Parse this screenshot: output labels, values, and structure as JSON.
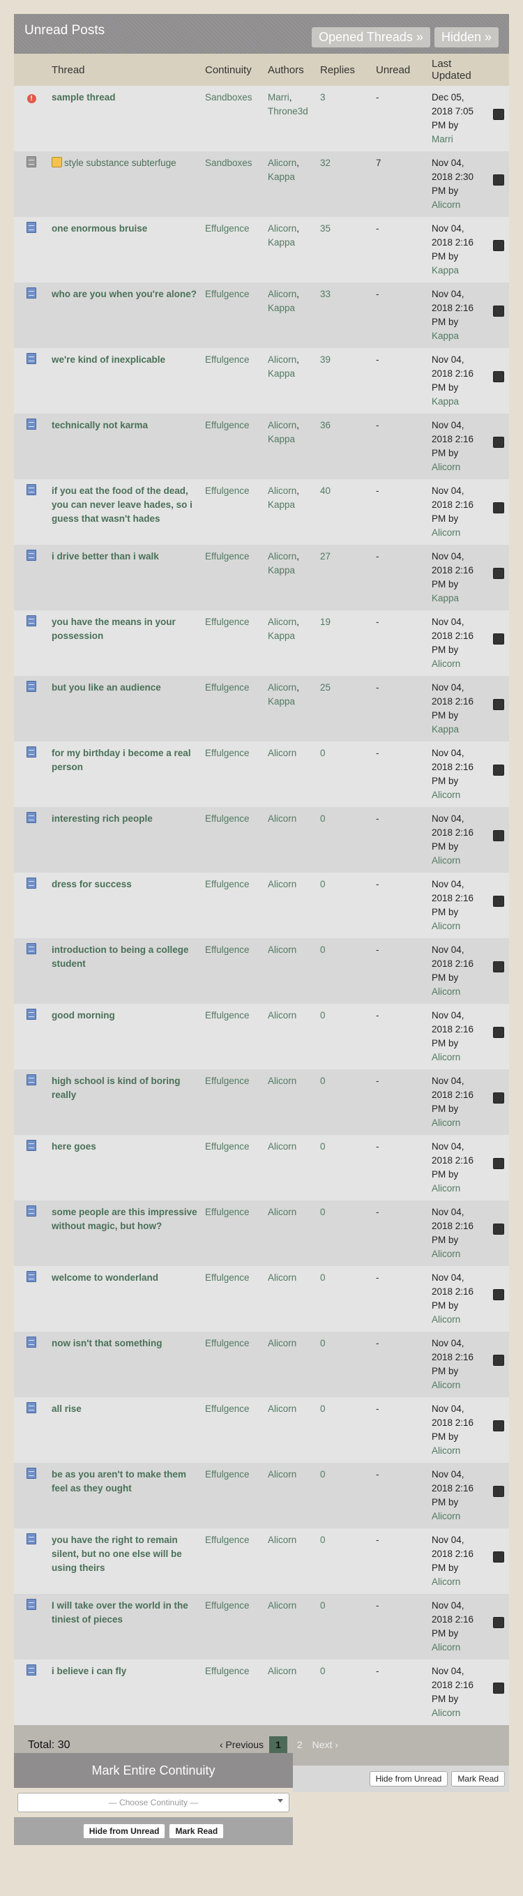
{
  "header": {
    "title": "Unread Posts",
    "opened_threads_label": "Opened Threads »",
    "hidden_label": "Hidden »"
  },
  "columns": {
    "thread": "Thread",
    "continuity": "Continuity",
    "authors": "Authors",
    "replies": "Replies",
    "unread": "Unread",
    "last_updated": "Last Updated"
  },
  "rows": [
    {
      "icon": "alert-icon",
      "title": "sample thread",
      "continuity": "Sandboxes",
      "authors": [
        "Marri",
        "Throne3d"
      ],
      "replies": "3",
      "unread": "-",
      "updated": "Dec 05, 2018 7:05 PM by",
      "updated_by": "Marri"
    },
    {
      "icon": "sandbox-icon",
      "title": "style substance subterfuge",
      "continuity": "Sandboxes",
      "authors": [
        "Alicorn",
        "Kappa"
      ],
      "replies": "32",
      "unread": "7",
      "updated": "Nov 04, 2018 2:30 PM by",
      "updated_by": "Alicorn"
    },
    {
      "icon": "doc-icon",
      "title": "one enormous bruise",
      "continuity": "Effulgence",
      "authors": [
        "Alicorn",
        "Kappa"
      ],
      "replies": "35",
      "unread": "-",
      "updated": "Nov 04, 2018 2:16 PM by",
      "updated_by": "Kappa"
    },
    {
      "icon": "doc-icon",
      "title": "who are you when you're alone?",
      "continuity": "Effulgence",
      "authors": [
        "Alicorn",
        "Kappa"
      ],
      "replies": "33",
      "unread": "-",
      "updated": "Nov 04, 2018 2:16 PM by",
      "updated_by": "Kappa"
    },
    {
      "icon": "doc-icon",
      "title": "we're kind of inexplicable",
      "continuity": "Effulgence",
      "authors": [
        "Alicorn",
        "Kappa"
      ],
      "replies": "39",
      "unread": "-",
      "updated": "Nov 04, 2018 2:16 PM by",
      "updated_by": "Kappa"
    },
    {
      "icon": "doc-icon",
      "title": "technically not karma",
      "continuity": "Effulgence",
      "authors": [
        "Alicorn",
        "Kappa"
      ],
      "replies": "36",
      "unread": "-",
      "updated": "Nov 04, 2018 2:16 PM by",
      "updated_by": "Alicorn"
    },
    {
      "icon": "doc-icon",
      "title": "if you eat the food of the dead, you can never leave hades, so i guess that wasn't hades",
      "continuity": "Effulgence",
      "authors": [
        "Alicorn",
        "Kappa"
      ],
      "replies": "40",
      "unread": "-",
      "updated": "Nov 04, 2018 2:16 PM by",
      "updated_by": "Alicorn"
    },
    {
      "icon": "doc-icon",
      "title": "i drive better than i walk",
      "continuity": "Effulgence",
      "authors": [
        "Alicorn",
        "Kappa"
      ],
      "replies": "27",
      "unread": "-",
      "updated": "Nov 04, 2018 2:16 PM by",
      "updated_by": "Kappa"
    },
    {
      "icon": "doc-icon",
      "title": "you have the means in your possession",
      "continuity": "Effulgence",
      "authors": [
        "Alicorn",
        "Kappa"
      ],
      "replies": "19",
      "unread": "-",
      "updated": "Nov 04, 2018 2:16 PM by",
      "updated_by": "Alicorn"
    },
    {
      "icon": "doc-icon",
      "title": "but you like an audience",
      "continuity": "Effulgence",
      "authors": [
        "Alicorn",
        "Kappa"
      ],
      "replies": "25",
      "unread": "-",
      "updated": "Nov 04, 2018 2:16 PM by",
      "updated_by": "Kappa"
    },
    {
      "icon": "doc-icon",
      "title": "for my birthday i become a real person",
      "continuity": "Effulgence",
      "authors": [
        "Alicorn"
      ],
      "replies": "0",
      "unread": "-",
      "updated": "Nov 04, 2018 2:16 PM by",
      "updated_by": "Alicorn"
    },
    {
      "icon": "doc-icon",
      "title": "interesting rich people",
      "continuity": "Effulgence",
      "authors": [
        "Alicorn"
      ],
      "replies": "0",
      "unread": "-",
      "updated": "Nov 04, 2018 2:16 PM by",
      "updated_by": "Alicorn"
    },
    {
      "icon": "doc-icon",
      "title": "dress for success",
      "continuity": "Effulgence",
      "authors": [
        "Alicorn"
      ],
      "replies": "0",
      "unread": "-",
      "updated": "Nov 04, 2018 2:16 PM by",
      "updated_by": "Alicorn"
    },
    {
      "icon": "doc-icon",
      "title": "introduction to being a college student",
      "continuity": "Effulgence",
      "authors": [
        "Alicorn"
      ],
      "replies": "0",
      "unread": "-",
      "updated": "Nov 04, 2018 2:16 PM by",
      "updated_by": "Alicorn"
    },
    {
      "icon": "doc-icon",
      "title": "good morning",
      "continuity": "Effulgence",
      "authors": [
        "Alicorn"
      ],
      "replies": "0",
      "unread": "-",
      "updated": "Nov 04, 2018 2:16 PM by",
      "updated_by": "Alicorn"
    },
    {
      "icon": "doc-icon",
      "title": "high school is kind of boring really",
      "continuity": "Effulgence",
      "authors": [
        "Alicorn"
      ],
      "replies": "0",
      "unread": "-",
      "updated": "Nov 04, 2018 2:16 PM by",
      "updated_by": "Alicorn"
    },
    {
      "icon": "doc-icon",
      "title": "here goes",
      "continuity": "Effulgence",
      "authors": [
        "Alicorn"
      ],
      "replies": "0",
      "unread": "-",
      "updated": "Nov 04, 2018 2:16 PM by",
      "updated_by": "Alicorn"
    },
    {
      "icon": "doc-icon",
      "title": "some people are this impressive without magic, but how?",
      "continuity": "Effulgence",
      "authors": [
        "Alicorn"
      ],
      "replies": "0",
      "unread": "-",
      "updated": "Nov 04, 2018 2:16 PM by",
      "updated_by": "Alicorn"
    },
    {
      "icon": "doc-icon",
      "title": "welcome to wonderland",
      "continuity": "Effulgence",
      "authors": [
        "Alicorn"
      ],
      "replies": "0",
      "unread": "-",
      "updated": "Nov 04, 2018 2:16 PM by",
      "updated_by": "Alicorn"
    },
    {
      "icon": "doc-icon",
      "title": "now isn't that something",
      "continuity": "Effulgence",
      "authors": [
        "Alicorn"
      ],
      "replies": "0",
      "unread": "-",
      "updated": "Nov 04, 2018 2:16 PM by",
      "updated_by": "Alicorn"
    },
    {
      "icon": "doc-icon",
      "title": "all rise",
      "continuity": "Effulgence",
      "authors": [
        "Alicorn"
      ],
      "replies": "0",
      "unread": "-",
      "updated": "Nov 04, 2018 2:16 PM by",
      "updated_by": "Alicorn"
    },
    {
      "icon": "doc-icon",
      "title": "be as you aren't to make them feel as they ought",
      "continuity": "Effulgence",
      "authors": [
        "Alicorn"
      ],
      "replies": "0",
      "unread": "-",
      "updated": "Nov 04, 2018 2:16 PM by",
      "updated_by": "Alicorn"
    },
    {
      "icon": "doc-icon",
      "title": "you have the right to remain silent, but no one else will be using theirs",
      "continuity": "Effulgence",
      "authors": [
        "Alicorn"
      ],
      "replies": "0",
      "unread": "-",
      "updated": "Nov 04, 2018 2:16 PM by",
      "updated_by": "Alicorn"
    },
    {
      "icon": "doc-icon",
      "title": "I will take over the world in the tiniest of pieces",
      "continuity": "Effulgence",
      "authors": [
        "Alicorn"
      ],
      "replies": "0",
      "unread": "-",
      "updated": "Nov 04, 2018 2:16 PM by",
      "updated_by": "Alicorn"
    },
    {
      "icon": "doc-icon",
      "title": "i believe i can fly",
      "continuity": "Effulgence",
      "authors": [
        "Alicorn"
      ],
      "replies": "0",
      "unread": "-",
      "updated": "Nov 04, 2018 2:16 PM by",
      "updated_by": "Alicorn"
    }
  ],
  "footer": {
    "total": "Total: 30",
    "prev": "‹ Previous",
    "pages": [
      "1",
      "2"
    ],
    "current_page": "1",
    "next": "Next ›",
    "hide_from_unread": "Hide from Unread",
    "mark_read": "Mark Read"
  },
  "mark_continuity": {
    "title": "Mark Entire Continuity",
    "select_placeholder": "— Choose Continuity —",
    "hide_from_unread": "Hide from Unread",
    "mark_read": "Mark Read"
  },
  "colors": {
    "header_bg": "#8f8d8e",
    "column_header_bg": "#d8d1bf",
    "link": "#527a62",
    "page_bg": "#e6dfd1"
  }
}
